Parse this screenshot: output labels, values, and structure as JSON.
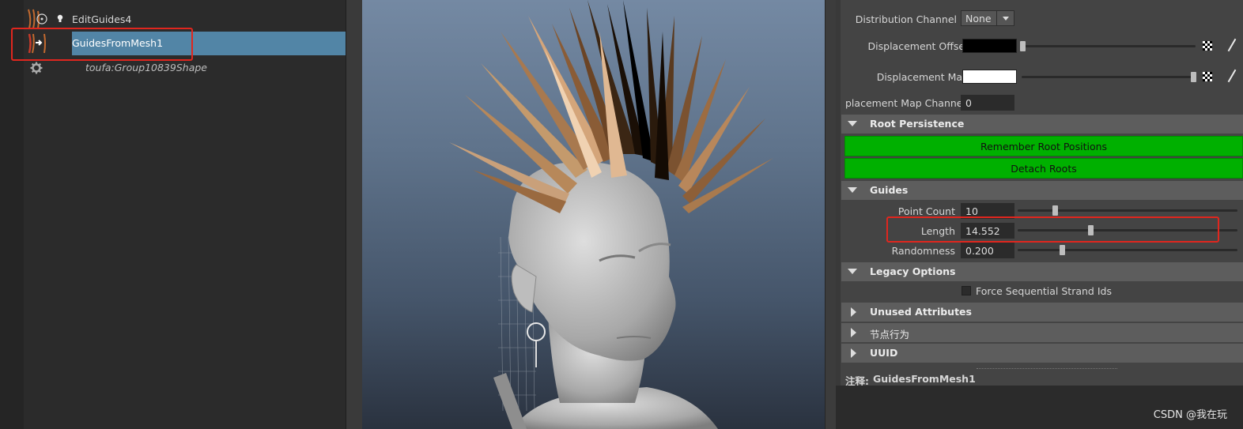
{
  "outliner": {
    "rows": [
      {
        "label": "EditGuides4"
      },
      {
        "label": "GuidesFromMesh1"
      },
      {
        "label": "toufa:Group10839Shape"
      }
    ]
  },
  "attr": {
    "distribution_channel": {
      "label": "Distribution Channel",
      "value": "None"
    },
    "displacement_offset": {
      "label": "Displacement Offset"
    },
    "displacement_map": {
      "label": "Displacement Map"
    },
    "displacement_map_channel": {
      "label": "placement Map Channel",
      "value": "0"
    },
    "sections": {
      "root_persistence": "Root Persistence",
      "guides": "Guides",
      "legacy_options": "Legacy Options",
      "unused_attributes": "Unused Attributes",
      "node_behavior": "节点行为",
      "uuid": "UUID"
    },
    "buttons": {
      "remember_root_positions": "Remember Root Positions",
      "detach_roots": "Detach Roots"
    },
    "point_count": {
      "label": "Point Count",
      "value": "10",
      "slider_fraction": 0.17
    },
    "length": {
      "label": "Length",
      "value": "14.552",
      "slider_fraction": 0.33
    },
    "randomness": {
      "label": "Randomness",
      "value": "0.200",
      "slider_fraction": 0.2
    },
    "force_sequential": {
      "label": "Force Sequential Strand Ids",
      "checked": false
    },
    "notes": {
      "label": "注释:",
      "value": "GuidesFromMesh1"
    }
  },
  "watermark": "CSDN @我在玩",
  "colors": {
    "selection": "#5285a6",
    "highlight_box": "#e0261e",
    "green_button": "#00b000"
  }
}
